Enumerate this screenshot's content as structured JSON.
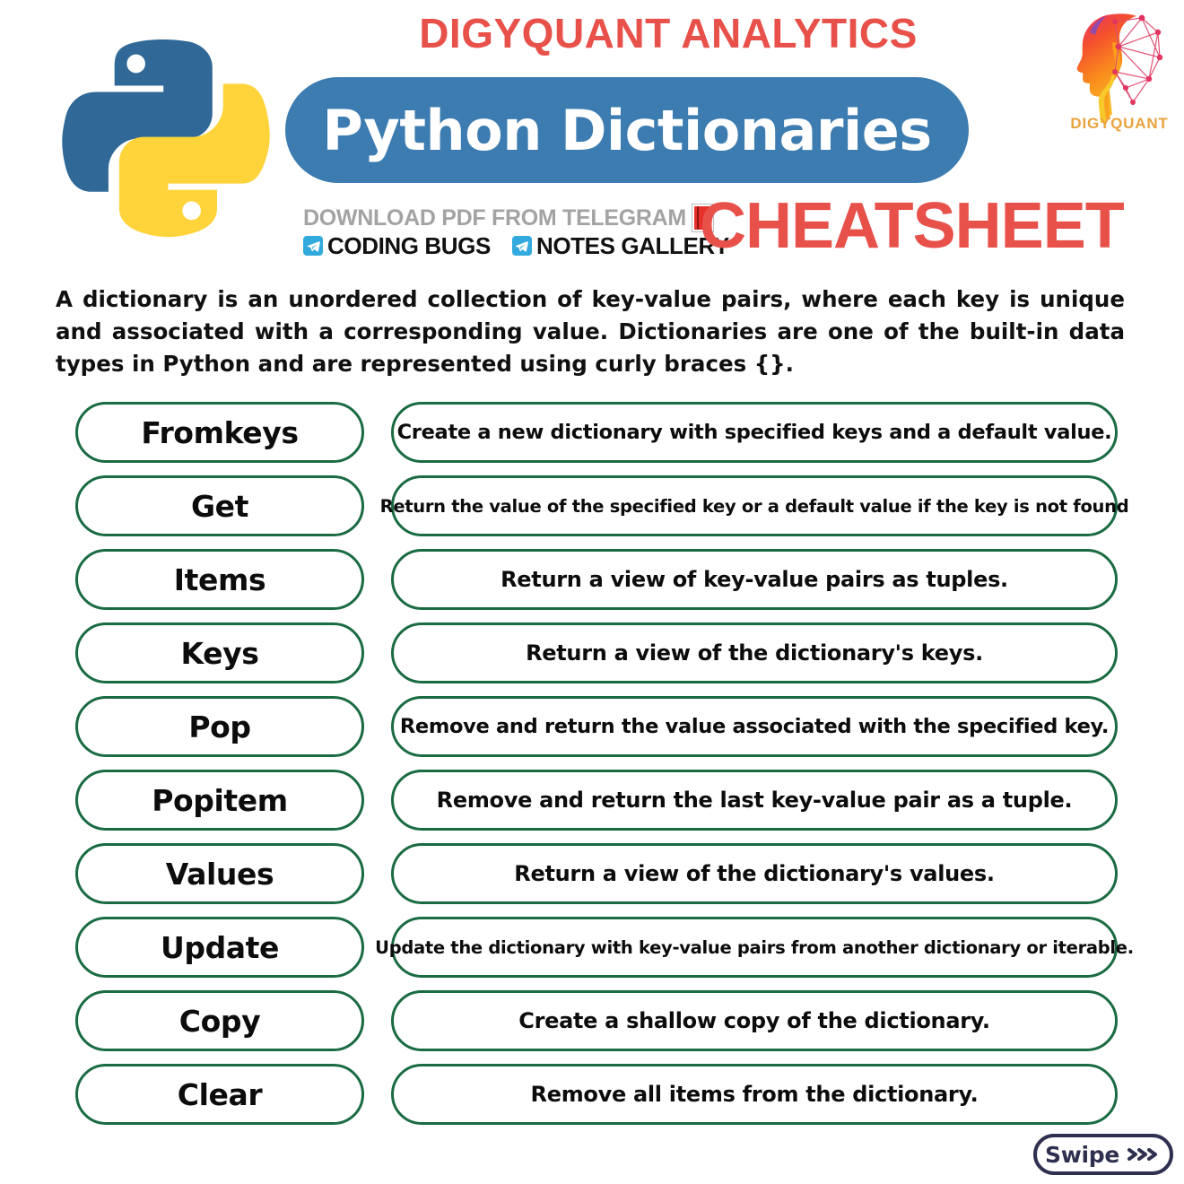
{
  "header": {
    "brand_title": "DIGYQUANT ANALYTICS",
    "banner_title": "Python Dictionaries",
    "cheatsheet_label": "CHEATSHEET",
    "telegram_line1": "DOWNLOAD PDF FROM TELEGRAM",
    "telegram_channel_1": "CODING BUGS",
    "telegram_channel_2": "NOTES GALLERY",
    "logo_wordmark": "DIGYQUANT",
    "icons": {
      "python": "python-logo-icon",
      "book": "red-book-icon",
      "telegram": "telegram-paper-plane-icon",
      "brand_head": "digyquant-head-network-icon"
    }
  },
  "intro": {
    "text": "A dictionary is an unordered collection of key-value pairs, where each key is unique and associated with a corresponding value. Dictionaries are one of the built-in data types in Python and are represented using curly braces {}."
  },
  "methods": [
    {
      "name": "Fromkeys",
      "description": "Create a new dictionary with specified keys and a default value.",
      "size": "md"
    },
    {
      "name": "Get",
      "description": "Return the value of the specified key or a default value if the key is not found",
      "size": "sm"
    },
    {
      "name": "Items",
      "description": "Return a view of key-value pairs as tuples.",
      "size": "lg"
    },
    {
      "name": "Keys",
      "description": "Return a view of the dictionary's keys.",
      "size": "lg"
    },
    {
      "name": "Pop",
      "description": "Remove and return the value associated with the specified key.",
      "size": "md"
    },
    {
      "name": "Popitem",
      "description": "Remove and return the last key-value pair as a tuple.",
      "size": "lg"
    },
    {
      "name": "Values",
      "description": "Return a view of the dictionary's values.",
      "size": "lg"
    },
    {
      "name": "Update",
      "description": "Update the dictionary with key-value pairs from another dictionary or iterable.",
      "size": "sm"
    },
    {
      "name": "Copy",
      "description": "Create a shallow copy of the dictionary.",
      "size": "lg"
    },
    {
      "name": "Clear",
      "description": "Remove all items from the dictionary.",
      "size": "lg"
    }
  ],
  "footer": {
    "swipe_label": "Swipe",
    "swipe_icon": "triple-chevron-right-icon"
  },
  "colors": {
    "brand_red": "#e8504a",
    "banner_blue": "#3c7cb0",
    "pill_green": "#1a6b42",
    "telegram_blue": "#33aadd",
    "swipe_navy": "#2f3050",
    "wordmark_orange": "#e8a33d",
    "python_blue": "#306998",
    "python_yellow": "#ffd43b"
  }
}
